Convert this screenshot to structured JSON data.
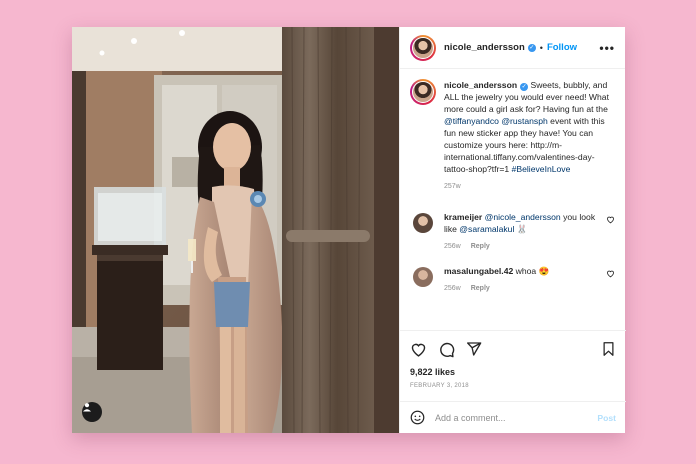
{
  "post": {
    "username": "nicole_andersson",
    "follow_label": "Follow",
    "caption": {
      "username": "nicole_andersson",
      "text_1": " Sweets, bubbly, and ALL the jewelry you would ever need! What more could a girl ask for? Having fun at the ",
      "mention_1": "@tiffanyandco",
      "text_2": " ",
      "mention_2": "@rustansph",
      "text_3": " event with this fun new sticker app they have! You can customize yours here: http://m-international.tiffany.com/valentines-day-tattoo-shop?tfr=1 ",
      "hashtag": "#BelieveInLove",
      "age": "257w"
    },
    "comments": [
      {
        "username": "krameijer",
        "mention": "@nicole_andersson",
        "text": " you look like ",
        "mention_2": "@saramalakul",
        "emoji": "🐰",
        "age": "256w",
        "reply": "Reply",
        "avatar_color": "#c8a590"
      },
      {
        "username": "masalungabel.42",
        "text": " whoa ",
        "emoji": "😍",
        "age": "256w",
        "reply": "Reply",
        "avatar_color": "#a6897c"
      }
    ],
    "likes": "9,822 likes",
    "date": "FEBRUARY 3, 2018",
    "add_comment_placeholder": "Add a comment...",
    "post_label": "Post"
  },
  "colors": {
    "background": "#f6b7cf",
    "link": "#00376b",
    "follow": "#0095f6",
    "verified": "#3897f0"
  },
  "icons": [
    "user-tag-icon",
    "verified-icon",
    "more-icon",
    "heart-icon",
    "comment-icon",
    "share-icon",
    "save-icon",
    "emoji-icon"
  ]
}
